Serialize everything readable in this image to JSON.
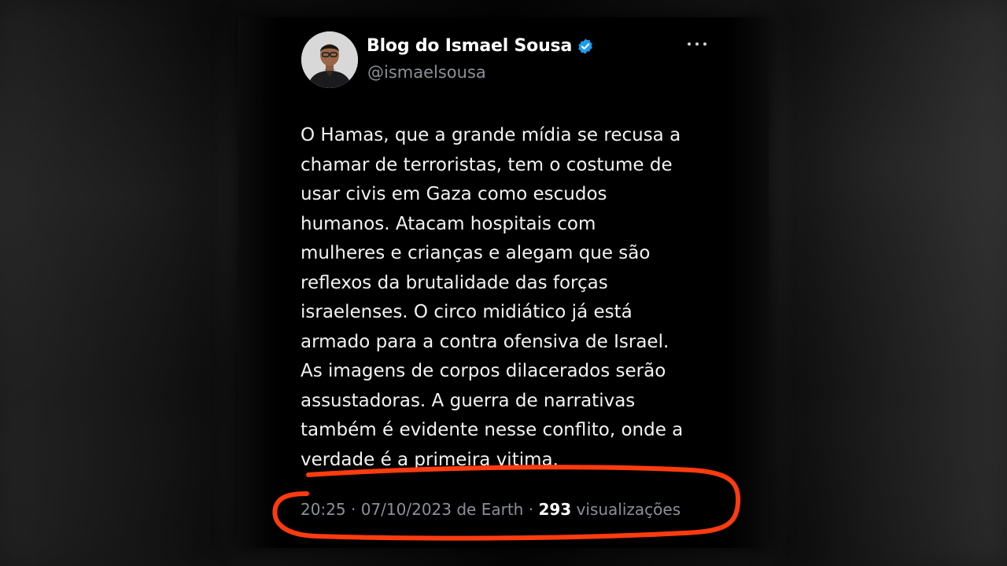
{
  "tweet": {
    "author": {
      "display_name": "Blog do Ismael Sousa",
      "handle": "@ismaelsousa",
      "verified": true,
      "verified_color": "#1d9bf0"
    },
    "more_icon": "ellipsis-horizontal-icon",
    "text": "O Hamas, que a grande mídia se recusa a\nchamar de terroristas, tem o costume de\nusar civis em Gaza como escudos\nhumanos. Atacam hospitais com\nmulheres e crianças e alegam que são\nreflexos da brutalidade das forças\nisraelenses. O circo midiático já está\narmado para a contra ofensiva de Israel.\nAs imagens de corpos dilacerados serão\nassustadoras. A guerra de narrativas\ntambém é evidente nesse conflito, onde a\nverdade é a primeira vitima.",
    "meta": {
      "time": "20:25",
      "separator": " · ",
      "date": "07/10/2023",
      "source": " de Earth",
      "views_count": "293",
      "views_label": " visualizações"
    }
  },
  "colors": {
    "background": "#000000",
    "text_primary": "#f3f3f3",
    "text_secondary": "#8b9197",
    "annotation": "#ff3b0f"
  }
}
